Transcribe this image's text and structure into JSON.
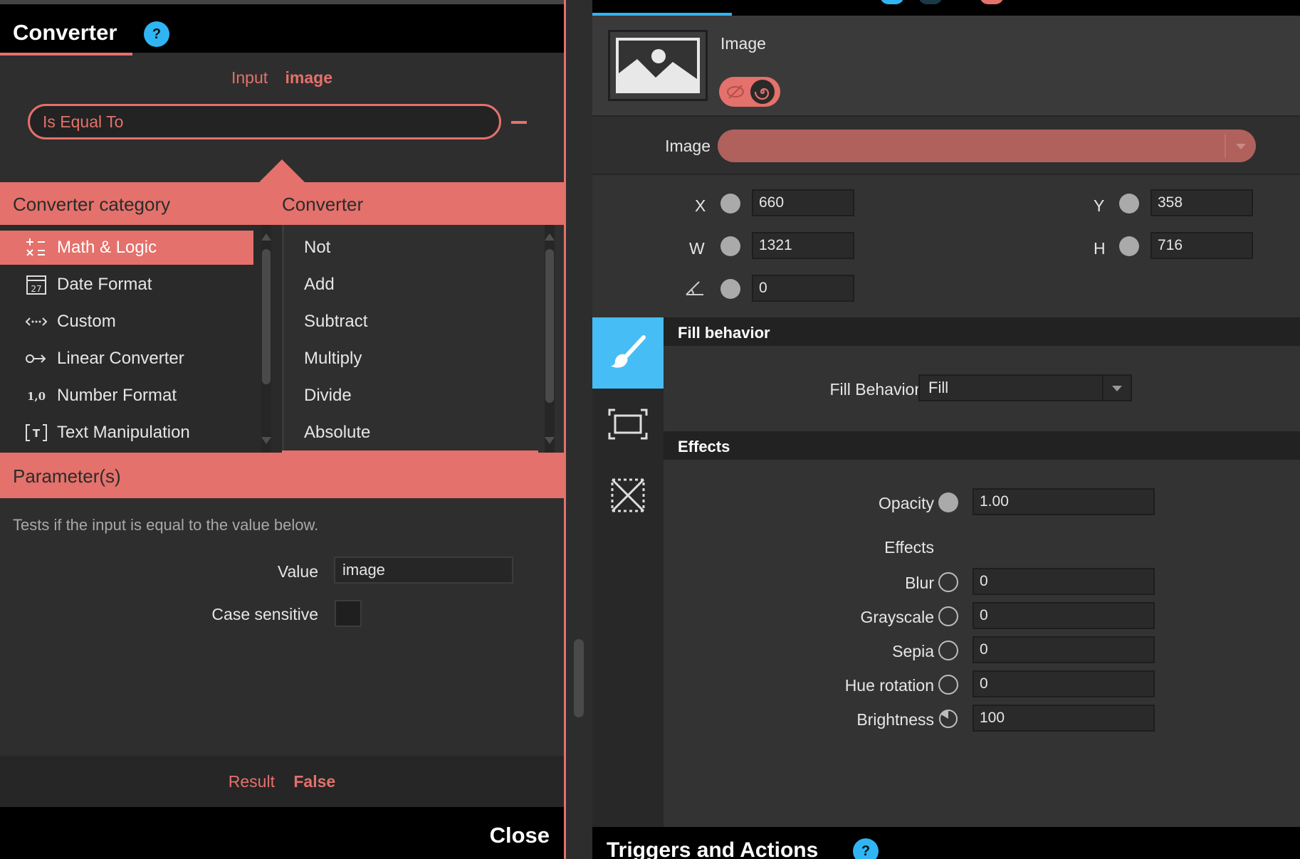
{
  "converter": {
    "title": "Converter",
    "help": "?",
    "input_label": "Input",
    "input_value": "image",
    "selected_converter": "Is Equal To",
    "category_header": "Converter category",
    "converter_header": "Converter",
    "categories": [
      {
        "label": "Math & Logic",
        "icon": "math-logic-icon",
        "glyph": "+−\n×="
      },
      {
        "label": "Date Format",
        "icon": "calendar-icon",
        "glyph": "27"
      },
      {
        "label": "Custom",
        "icon": "custom-arrows-icon",
        "glyph": "‹··›"
      },
      {
        "label": "Linear Converter",
        "icon": "linear-converter-icon",
        "glyph": "o→"
      },
      {
        "label": "Number Format",
        "icon": "number-format-icon",
        "glyph": "1,0"
      },
      {
        "label": "Text Manipulation",
        "icon": "text-manipulation-icon",
        "glyph": "[T]"
      }
    ],
    "converters": [
      "Not",
      "Add",
      "Subtract",
      "Multiply",
      "Divide",
      "Absolute"
    ],
    "parameters_header": "Parameter(s)",
    "description": "Tests if the input is equal to the value below.",
    "value_label": "Value",
    "value": "image",
    "case_sensitive_label": "Case sensitive",
    "case_sensitive": false,
    "result_label": "Result",
    "result_value": "False",
    "close_label": "Close",
    "accent": "#e4716b"
  },
  "properties": {
    "image_title": "Image",
    "image_label": "Image",
    "x_label": "X",
    "x": "660",
    "y_label": "Y",
    "y": "358",
    "w_label": "W",
    "w": "1321",
    "h_label": "H",
    "h": "716",
    "rotation": "0",
    "fill_section": "Fill behavior",
    "fill_label": "Fill Behavior",
    "fill_value": "Fill",
    "effects_section": "Effects",
    "opacity_label": "Opacity",
    "opacity": "1.00",
    "effects_label": "Effects",
    "effects": [
      {
        "label": "Blur",
        "value": "0"
      },
      {
        "label": "Grayscale",
        "value": "0"
      },
      {
        "label": "Sepia",
        "value": "0"
      },
      {
        "label": "Hue rotation",
        "value": "0"
      },
      {
        "label": "Brightness",
        "value": "100"
      }
    ],
    "triggers_title": "Triggers and Actions",
    "triggers_help": "?",
    "accent": "#46bdf4"
  }
}
